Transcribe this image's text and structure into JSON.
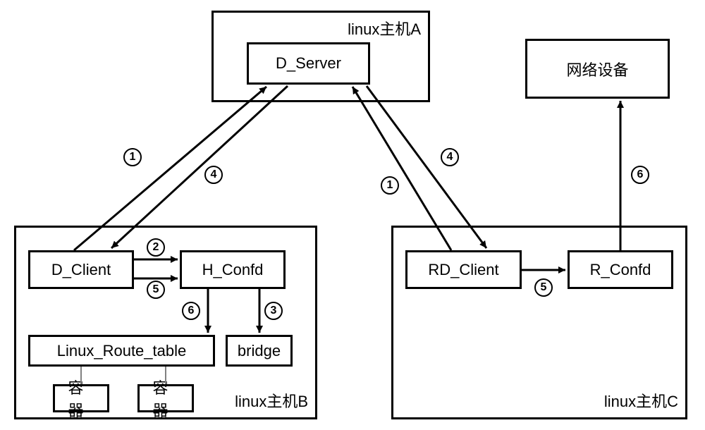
{
  "hostA": {
    "title": "linux主机A",
    "server": "D_Server"
  },
  "hostB": {
    "title": "linux主机B",
    "client": "D_Client",
    "confd": "H_Confd",
    "route": "Linux_Route_table",
    "bridge": "bridge",
    "container1": "容器",
    "container2": "容器"
  },
  "hostC": {
    "title": "linux主机C",
    "client": "RD_Client",
    "confd": "R_Confd"
  },
  "netDevice": "网络设备",
  "badges": {
    "b1a": "1",
    "b4a": "4",
    "b1b": "1",
    "b4b": "4",
    "b2": "2",
    "b5a": "5",
    "b6a": "6",
    "b3": "3",
    "b5b": "5",
    "b6b": "6"
  }
}
